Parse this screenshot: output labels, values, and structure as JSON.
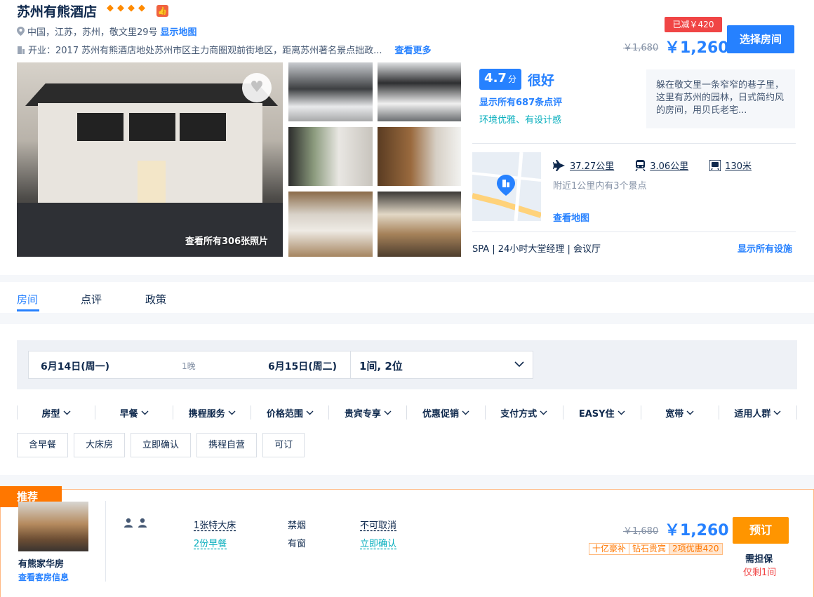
{
  "hotel": {
    "name": "苏州有熊酒店",
    "address": "中国，江苏，苏州，敬文里29号",
    "show_map": "显示地图",
    "opened_label": "开业：2017",
    "description": "苏州有熊酒店地处苏州市区主力商圈观前街地区，距离苏州著名景点拙政...",
    "see_more": "查看更多"
  },
  "pricing": {
    "saved": "已减￥420",
    "old_price": "￥1,680",
    "new_price": "￥1,260",
    "select_room": "选择房间"
  },
  "photos": {
    "view_all": "查看所有306张照片"
  },
  "rating": {
    "score": "4.7",
    "unit": "分",
    "word": "很好",
    "review_link": "显示所有687条点评",
    "tags": "环境优雅、有设计感",
    "quote": "躲在敬文里一条窄窄的巷子里，这里有苏州的园林，日式简约风的房间，用贝氏老宅..."
  },
  "location": {
    "airport_distance": "37.27公里",
    "train_distance": "3.06公里",
    "metro_distance": "130米",
    "nearby": "附近1公里内有3个景点",
    "view_map": "查看地图"
  },
  "facilities": {
    "list": "SPA | 24小时大堂经理 | 会议厅",
    "show_all": "显示所有设施"
  },
  "tabs": [
    "房间",
    "点评",
    "政策"
  ],
  "search": {
    "checkin": "6月14日(周一)",
    "nights": "1晚",
    "checkout": "6月15日(周二)",
    "guests": "1间, 2位"
  },
  "filters": [
    "房型",
    "早餐",
    "携程服务",
    "价格范围",
    "贵宾专享",
    "优惠促销",
    "支付方式",
    "EASY住",
    "宽带",
    "适用人群"
  ],
  "chips": [
    "含早餐",
    "大床房",
    "立即确认",
    "携程自营",
    "可订"
  ],
  "room": {
    "badge": "推荐",
    "name": "有熊家华房",
    "info_link": "查看客房信息",
    "bed": "1张特大床",
    "breakfast": "2份早餐",
    "smoking": "禁烟",
    "window": "有窗",
    "cancel": "不可取消",
    "confirm": "立即确认",
    "old_price": "￥1,680",
    "new_price": "￥1,260",
    "promo1": "十亿豪补",
    "promo2": "钻石贵宾",
    "promo3": "2项优惠420",
    "book": "预订",
    "guarantee": "需担保",
    "left": "仅剩1间"
  },
  "colors": {
    "brand_blue": "#2681ff",
    "orange": "#ff7700",
    "red": "#f04545",
    "teal": "#06aebd"
  }
}
